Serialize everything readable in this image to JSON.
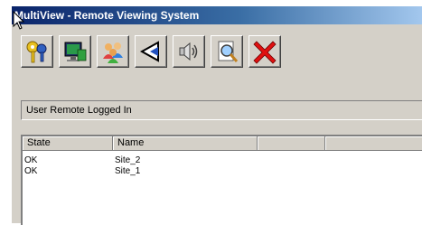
{
  "window": {
    "title": "MultiView - Remote Viewing System"
  },
  "toolbar": {
    "buttons": [
      {
        "name": "keys"
      },
      {
        "name": "monitor"
      },
      {
        "name": "users"
      },
      {
        "name": "back"
      },
      {
        "name": "speaker"
      },
      {
        "name": "magnifier"
      },
      {
        "name": "close"
      }
    ]
  },
  "status": {
    "text": "User Remote Logged In"
  },
  "list": {
    "columns": [
      "State",
      "Name",
      ""
    ],
    "rows": [
      {
        "state": "OK",
        "name": "Site_2"
      },
      {
        "state": "OK",
        "name": "Site_1"
      }
    ]
  }
}
